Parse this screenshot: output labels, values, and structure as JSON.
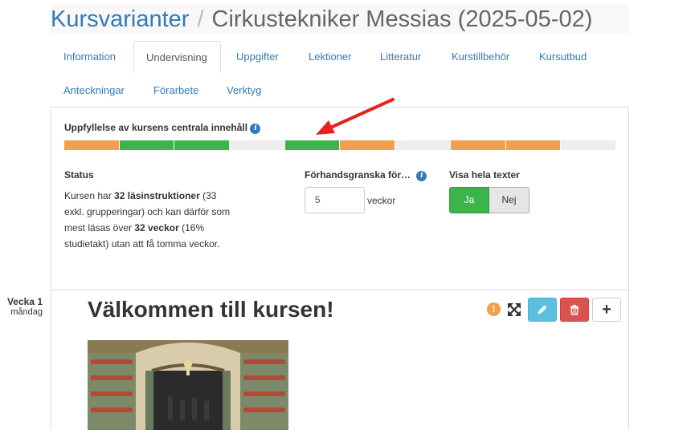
{
  "breadcrumb": {
    "parent": "Kursvarianter",
    "separator": "/",
    "current": "Cirkustekniker Messias (2025-05-02)"
  },
  "tabs": [
    {
      "label": "Information",
      "active": false
    },
    {
      "label": "Undervisning",
      "active": true
    },
    {
      "label": "Uppgifter",
      "active": false
    },
    {
      "label": "Lektioner",
      "active": false
    },
    {
      "label": "Litteratur",
      "active": false
    },
    {
      "label": "Kurstillbehör",
      "active": false
    },
    {
      "label": "Kursutbud",
      "active": false
    },
    {
      "label": "Anteckningar",
      "active": false
    },
    {
      "label": "Förarbete",
      "active": false
    },
    {
      "label": "Verktyg",
      "active": false
    }
  ],
  "progress": {
    "label": "Uppfyllelse av kursens centrala innehåll",
    "segments": [
      "orange",
      "green",
      "green",
      "empty",
      "green",
      "orange",
      "empty",
      "orange",
      "orange",
      "empty"
    ]
  },
  "status": {
    "label": "Status",
    "text_1": "Kursen har ",
    "count_instructions": "32 läsinstruktioner",
    "text_2": " (33 exkl. grupperingar) och kan därför som mest läsas över ",
    "count_weeks": "32 veckor",
    "text_3": " (16% studietakt) utan att få tomma veckor."
  },
  "preview": {
    "label": "Förhandsgranska för…",
    "value": "5",
    "unit": "veckor"
  },
  "full_texts": {
    "label": "Visa hela texter",
    "yes": "Ja",
    "no": "Nej",
    "selected": "Ja"
  },
  "lesson": {
    "week": "Vecka 1",
    "day": "måndag",
    "title": "Välkommen till kursen!",
    "warning_glyph": "!",
    "add_glyph": "+"
  },
  "colors": {
    "link": "#337ab7",
    "green": "#3bb54a",
    "orange": "#f0a04b",
    "info": "#5bc0de",
    "danger": "#d9534f"
  }
}
